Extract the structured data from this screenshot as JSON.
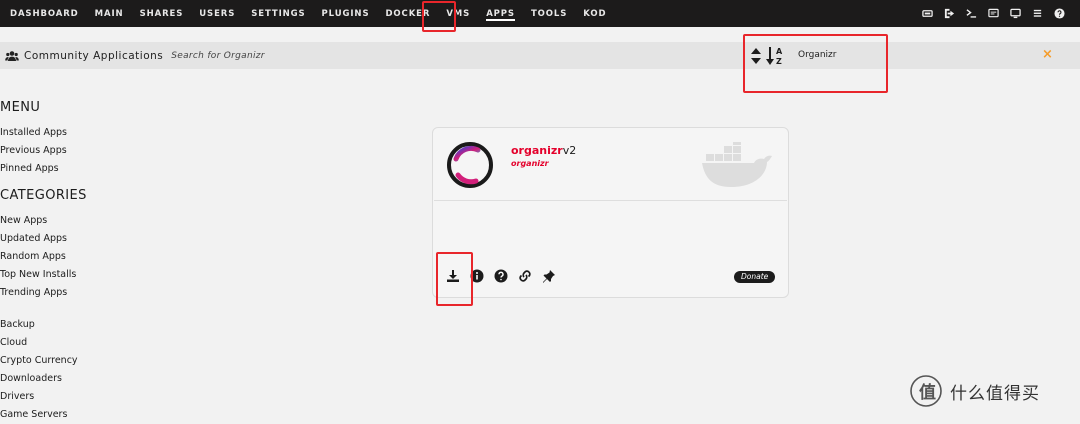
{
  "nav": {
    "items": [
      {
        "label": "DASHBOARD"
      },
      {
        "label": "MAIN"
      },
      {
        "label": "SHARES"
      },
      {
        "label": "USERS"
      },
      {
        "label": "SETTINGS"
      },
      {
        "label": "PLUGINS"
      },
      {
        "label": "DOCKER"
      },
      {
        "label": "VMS"
      },
      {
        "label": "APPS",
        "active": true
      },
      {
        "label": "TOOLS"
      },
      {
        "label": "KOD"
      }
    ],
    "icons": [
      "switch-icon",
      "logout-icon",
      "terminal-icon",
      "feedback-icon",
      "monitor-icon",
      "log-icon",
      "help-icon"
    ]
  },
  "titlebar": {
    "title": "Community Applications",
    "search_label": "Search for Organizr",
    "query": "Organizr",
    "close": "×"
  },
  "sidebar": {
    "menu_heading": "MENU",
    "menu_items": [
      "Installed Apps",
      "Previous Apps",
      "Pinned Apps"
    ],
    "categories_heading": "CATEGORIES",
    "category_items": [
      "New Apps",
      "Updated Apps",
      "Random Apps",
      "Top New Installs",
      "Trending Apps"
    ],
    "more_items": [
      "Backup",
      "Cloud",
      "Crypto Currency",
      "Downloaders",
      "Drivers",
      "Game Servers"
    ]
  },
  "card": {
    "name_main": "organizr",
    "name_suffix": "v2",
    "author": "organizr",
    "donate": "Donate"
  },
  "watermark": {
    "text": "什么值得买"
  },
  "colors": {
    "nav_bg": "#1c1b1b",
    "accent_red": "#e4002b",
    "highlight": "#e8262b",
    "close_orange": "#f59c2a"
  }
}
